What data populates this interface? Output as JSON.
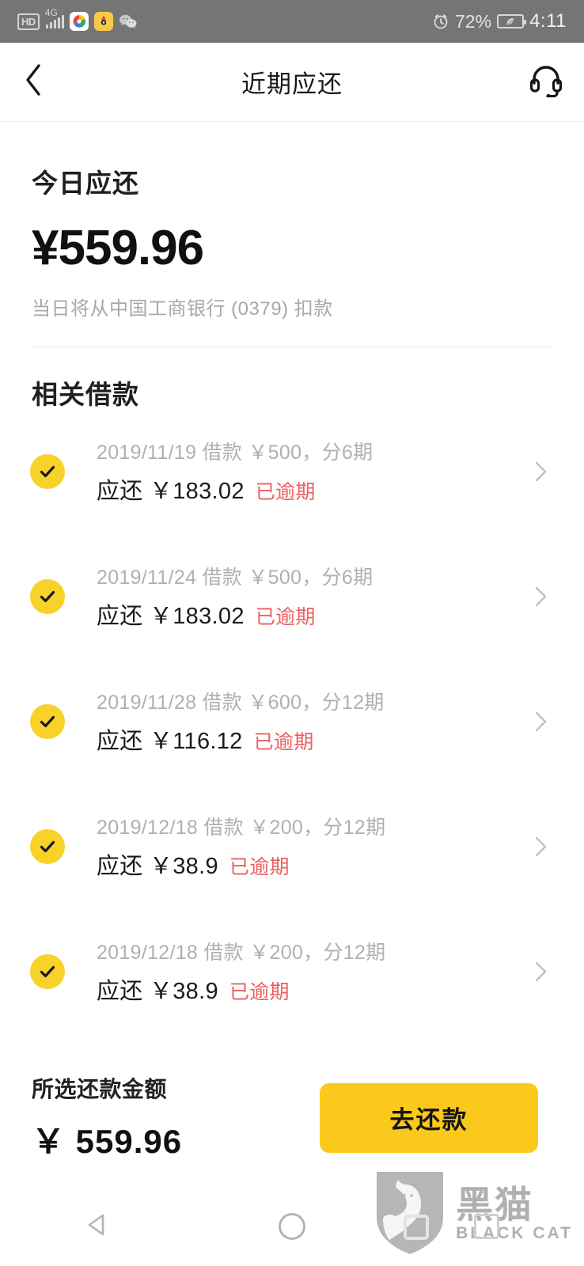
{
  "status_bar": {
    "hd_label": "HD",
    "network_label": "4G",
    "battery_percent": "72%",
    "time": "4:11",
    "icons": [
      "hd-icon",
      "signal-icon",
      "uc-browser-icon",
      "weibo-icon",
      "wechat-icon",
      "alarm-icon",
      "battery-saver-icon"
    ]
  },
  "header": {
    "title": "近期应还",
    "back_icon": "chevron-left-icon",
    "service_icon": "headset-icon"
  },
  "summary": {
    "label": "今日应还",
    "amount": "¥559.96",
    "note": "当日将从中国工商银行 (0379) 扣款"
  },
  "loans_section": {
    "title": "相关借款",
    "items": [
      {
        "meta": "2019/11/19 借款 ￥500，分6期",
        "due": "应还 ￥183.02",
        "status": "已逾期",
        "checked": true
      },
      {
        "meta": "2019/11/24 借款 ￥500，分6期",
        "due": "应还 ￥183.02",
        "status": "已逾期",
        "checked": true
      },
      {
        "meta": "2019/11/28 借款 ￥600，分12期",
        "due": "应还 ￥116.12",
        "status": "已逾期",
        "checked": true
      },
      {
        "meta": "2019/12/18 借款 ￥200，分12期",
        "due": "应还 ￥38.9",
        "status": "已逾期",
        "checked": true
      },
      {
        "meta": "2019/12/18 借款 ￥200，分12期",
        "due": "应还 ￥38.9",
        "status": "已逾期",
        "checked": true
      }
    ]
  },
  "bottom_bar": {
    "total_label": "所选还款金额",
    "total_amount": "￥ 559.96",
    "pay_button_label": "去还款"
  },
  "watermark": {
    "cn": "黑猫",
    "en": "BLACK CAT",
    "logo_icon": "black-cat-shield-icon"
  },
  "system_nav": {
    "back_icon": "nav-back-triangle-icon",
    "home_icon": "nav-home-circle-icon",
    "recents_icon": "nav-recents-square-icon"
  },
  "colors": {
    "accent_yellow": "#FBC91B",
    "check_yellow": "#F8D229",
    "overdue_red": "#EC5F5F",
    "status_bar_gray": "#757575",
    "muted_gray": "#B0B0B0"
  }
}
